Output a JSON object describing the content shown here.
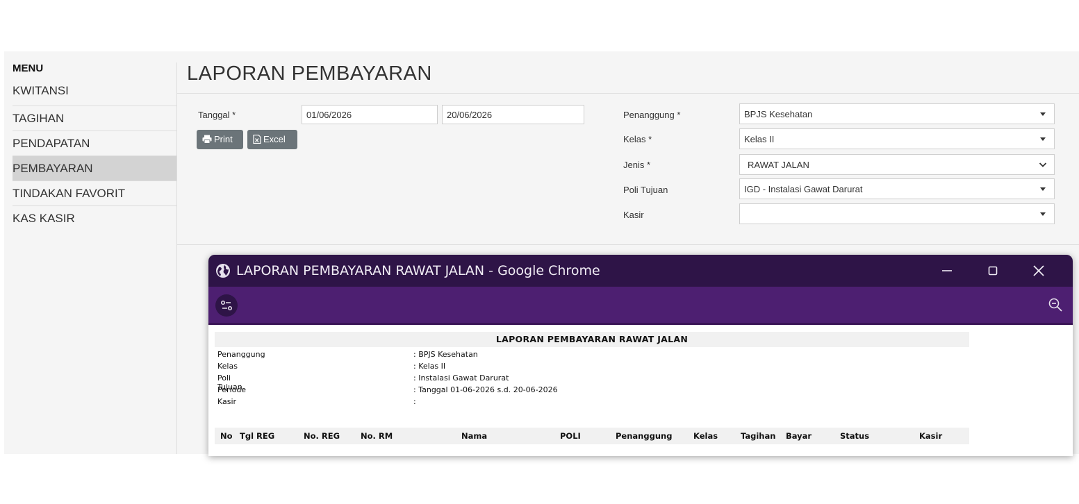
{
  "sidebar": {
    "menu_label": "MENU",
    "items": [
      {
        "label": "KWITANSI"
      },
      {
        "label": "TAGIHAN"
      },
      {
        "label": "PENDAPATAN"
      },
      {
        "label": "PEMBAYARAN",
        "active": true
      },
      {
        "label": "TINDAKAN FAVORIT"
      },
      {
        "label": "KAS KASIR"
      }
    ]
  },
  "page": {
    "title": "LAPORAN PEMBAYARAN"
  },
  "form": {
    "tanggal_label": "Tanggal *",
    "date_from": "01/06/2026",
    "date_to": "20/06/2026",
    "print_label": "Print",
    "excel_label": "Excel",
    "penanggung_label": "Penanggung *",
    "penanggung_value": "BPJS Kesehatan",
    "kelas_label": "Kelas *",
    "kelas_value": "Kelas II",
    "jenis_label": "Jenis *",
    "jenis_value": "RAWAT JALAN",
    "poli_label": "Poli Tujuan",
    "poli_value": "IGD - Instalasi Gawat Darurat",
    "kasir_label": "Kasir",
    "kasir_value": ""
  },
  "popup": {
    "window_title": "LAPORAN PEMBAYARAN RAWAT JALAN - Google Chrome",
    "title_bar_color": "#2e1447",
    "toolbar_color": "#4d1f71",
    "report": {
      "heading": "LAPORAN PEMBAYARAN RAWAT JALAN",
      "info": [
        {
          "key": "Penanggung",
          "value": ": BPJS Kesehatan"
        },
        {
          "key": "Kelas",
          "value": ": Kelas II"
        },
        {
          "key": "Poli Tujuan",
          "value": ": Instalasi Gawat Darurat"
        },
        {
          "key": "Periode",
          "value": ": Tanggal 01-06-2026 s.d. 20-06-2026"
        },
        {
          "key": "Kasir",
          "value": ":"
        }
      ],
      "columns": [
        "No",
        "Tgl REG",
        "No. REG",
        "No. RM",
        "Nama",
        "POLI",
        "Penanggung",
        "Kelas",
        "Tagihan",
        "Bayar",
        "Status",
        "Kasir"
      ]
    }
  }
}
